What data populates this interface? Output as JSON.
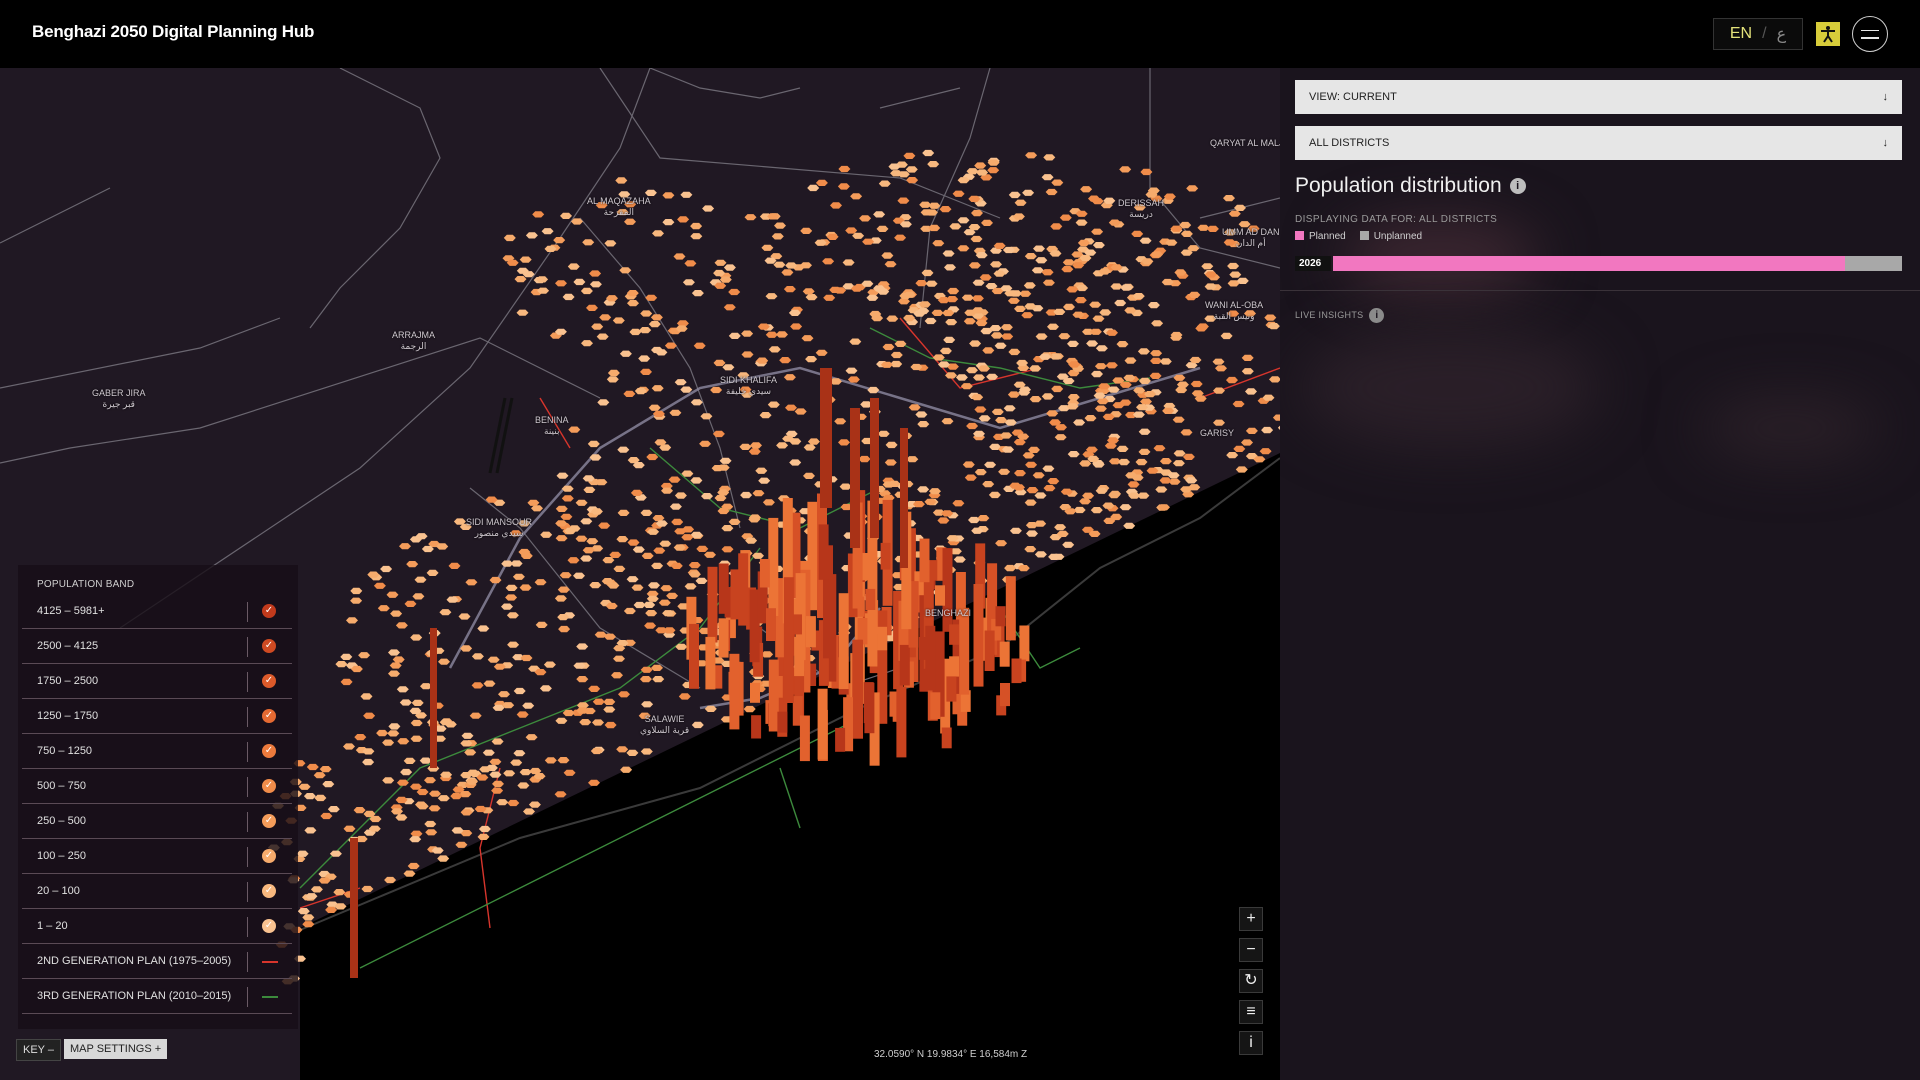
{
  "header": {
    "title": "Benghazi 2050 Digital Planning Hub",
    "lang_en": "EN",
    "lang_sep": "/",
    "lang_ar": "ع",
    "access_icon": "accessibility-icon",
    "menu_icon": "hamburger-menu-icon"
  },
  "map": {
    "places": [
      {
        "name": "AL MAQAZAHA",
        "ar": "المقزحة"
      },
      {
        "name": "ARRAJMA",
        "ar": "الرجمة"
      },
      {
        "name": "GABER JIRA",
        "ar": "قبر جيرة"
      },
      {
        "name": "BENINA",
        "ar": "بنينة"
      },
      {
        "name": "SIDI KHALIFA",
        "ar": "سيدي خليفة"
      },
      {
        "name": "SIDI MANSOUR",
        "ar": "سيدي منصور"
      },
      {
        "name": "BENGHAZI",
        "ar": ""
      },
      {
        "name": "SALAWIE",
        "ar": "قرية السلاوي"
      },
      {
        "name": "QARYAT AL MALJI",
        "ar": ""
      },
      {
        "name": "DERISSAH",
        "ar": "دريسة"
      },
      {
        "name": "UMM AD DAN",
        "ar": "أم الدان"
      },
      {
        "name": "WANI AL-OBA",
        "ar": "ونيس القبة"
      },
      {
        "name": "GARISY",
        "ar": ""
      }
    ],
    "coordinates": "32.0590° N 19.9834° E 16,584m Z",
    "controls": {
      "zoom_in": "+",
      "zoom_out": "−",
      "reset": "↻",
      "layers": "≡",
      "info": "i"
    }
  },
  "legend": {
    "title": "POPULATION BAND",
    "bands": [
      {
        "label": "4125 – 5981+",
        "color": "#c13a1c"
      },
      {
        "label": "2500 – 4125",
        "color": "#cf4a22"
      },
      {
        "label": "1750 – 2500",
        "color": "#dc5a2a"
      },
      {
        "label": "1250 – 1750",
        "color": "#e56a32"
      },
      {
        "label": "750 – 1250",
        "color": "#ec7a3c"
      },
      {
        "label": "500 – 750",
        "color": "#f08c4a"
      },
      {
        "label": "250 – 500",
        "color": "#f49c5a"
      },
      {
        "label": "100 – 250",
        "color": "#f6ab6c"
      },
      {
        "label": "20 – 100",
        "color": "#f8b87e"
      },
      {
        "label": "1 – 20",
        "color": "#f9c290"
      }
    ],
    "plans": [
      {
        "label": "2ND GENERATION PLAN (1975–2005)",
        "color": "#d7352c"
      },
      {
        "label": "3RD GENERATION PLAN (2010–2015)",
        "color": "#3c8a3c"
      }
    ],
    "key_button": "KEY –",
    "settings_button": "MAP SETTINGS +"
  },
  "panel": {
    "view_select": "VIEW: CURRENT",
    "district_select": "ALL DISTRICTS",
    "title": "Population distribution",
    "displaying": "DISPLAYING DATA FOR: ALL DISTRICTS",
    "legend_planned": "Planned",
    "legend_unplanned": "Unplanned",
    "planned_color": "#f277c0",
    "unplanned_color": "#a8a8a8",
    "year": "2026",
    "planned_fraction": 0.9,
    "live_insights": "LIVE INSIGHTS"
  }
}
